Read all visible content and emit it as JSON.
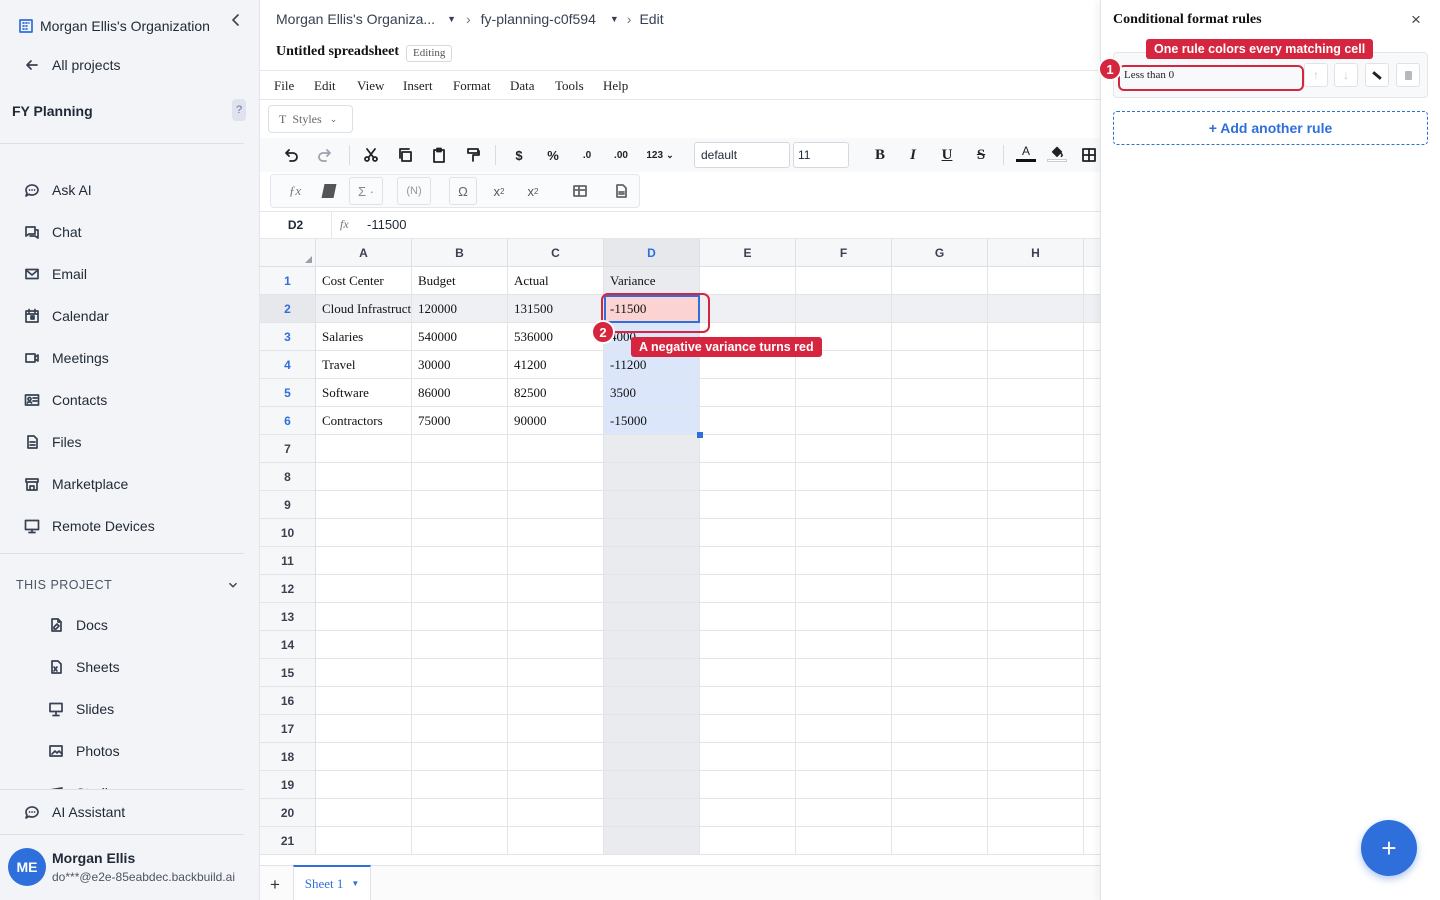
{
  "sidebar": {
    "org_name": "Morgan Ellis's Organization",
    "all_projects": "All projects",
    "project_name": "FY Planning",
    "help": "?",
    "nav": [
      {
        "label": "Ask AI",
        "icon": "chat-bubble-icon"
      },
      {
        "label": "Chat",
        "icon": "chat-icon"
      },
      {
        "label": "Email",
        "icon": "mail-icon"
      },
      {
        "label": "Calendar",
        "icon": "calendar-icon"
      },
      {
        "label": "Meetings",
        "icon": "video-icon"
      },
      {
        "label": "Contacts",
        "icon": "contact-card-icon"
      },
      {
        "label": "Files",
        "icon": "files-icon"
      },
      {
        "label": "Marketplace",
        "icon": "store-icon"
      },
      {
        "label": "Remote Devices",
        "icon": "monitor-icon"
      }
    ],
    "section_title": "THIS PROJECT",
    "project_items": [
      {
        "label": "Docs",
        "icon": "doc-icon"
      },
      {
        "label": "Sheets",
        "icon": "sheet-icon"
      },
      {
        "label": "Slides",
        "icon": "slides-icon"
      },
      {
        "label": "Photos",
        "icon": "photo-icon"
      },
      {
        "label": "Studio",
        "icon": "studio-icon"
      }
    ],
    "ai_assistant": "AI Assistant",
    "user": {
      "initials": "ME",
      "name": "Morgan Ellis",
      "email": "do***@e2e-85eabdec.backbuild.ai"
    }
  },
  "header": {
    "crumb_org": "Morgan Ellis's Organiza...",
    "crumb_project": "fy-planning-c0f594",
    "crumb_mode": "Edit",
    "doc_title": "Untitled spreadsheet",
    "status_badge": "Editing"
  },
  "menu": [
    "File",
    "Edit",
    "View",
    "Insert",
    "Format",
    "Data",
    "Tools",
    "Help"
  ],
  "toolbar": {
    "styles_label": "Styles",
    "font_value": "default",
    "size_value": "11",
    "num_format": "123",
    "decimal_dec": ".0",
    "decimal_inc": ".00"
  },
  "formula_bar": {
    "cell_ref": "D2",
    "fx": "fx",
    "value": "-11500"
  },
  "sheet": {
    "columns": [
      "A",
      "B",
      "C",
      "D",
      "E",
      "F",
      "G",
      "H"
    ],
    "rows": [
      "1",
      "2",
      "3",
      "4",
      "5",
      "6",
      "7",
      "8",
      "9",
      "10",
      "11",
      "12",
      "13",
      "14",
      "15",
      "16",
      "17",
      "18",
      "19",
      "20",
      "21"
    ],
    "data": [
      [
        "Cost Center",
        "Budget",
        "Actual",
        "Variance"
      ],
      [
        "Cloud Infrastructure",
        "120000",
        "131500",
        "-11500"
      ],
      [
        "Salaries",
        "540000",
        "536000",
        "4000"
      ],
      [
        "Travel",
        "30000",
        "41200",
        "-11200"
      ],
      [
        "Software",
        "86000",
        "82500",
        "3500"
      ],
      [
        "Contractors",
        "75000",
        "90000",
        "-15000"
      ]
    ],
    "tab_name": "Sheet 1",
    "add_sheet": "+"
  },
  "panel": {
    "title": "Conditional format rules",
    "close": "×",
    "rule_text": "Less than 0",
    "add_rule": "+ Add another rule",
    "fab": "+"
  },
  "callouts": [
    {
      "number": "1",
      "text": "One rule colors every matching cell"
    },
    {
      "number": "2",
      "text": "A negative variance turns red"
    }
  ],
  "colors": {
    "accent": "#2f6fdb",
    "callout": "#d6263f",
    "negative_fill": "#fbd3d3",
    "selection": "#dbe6fb"
  }
}
